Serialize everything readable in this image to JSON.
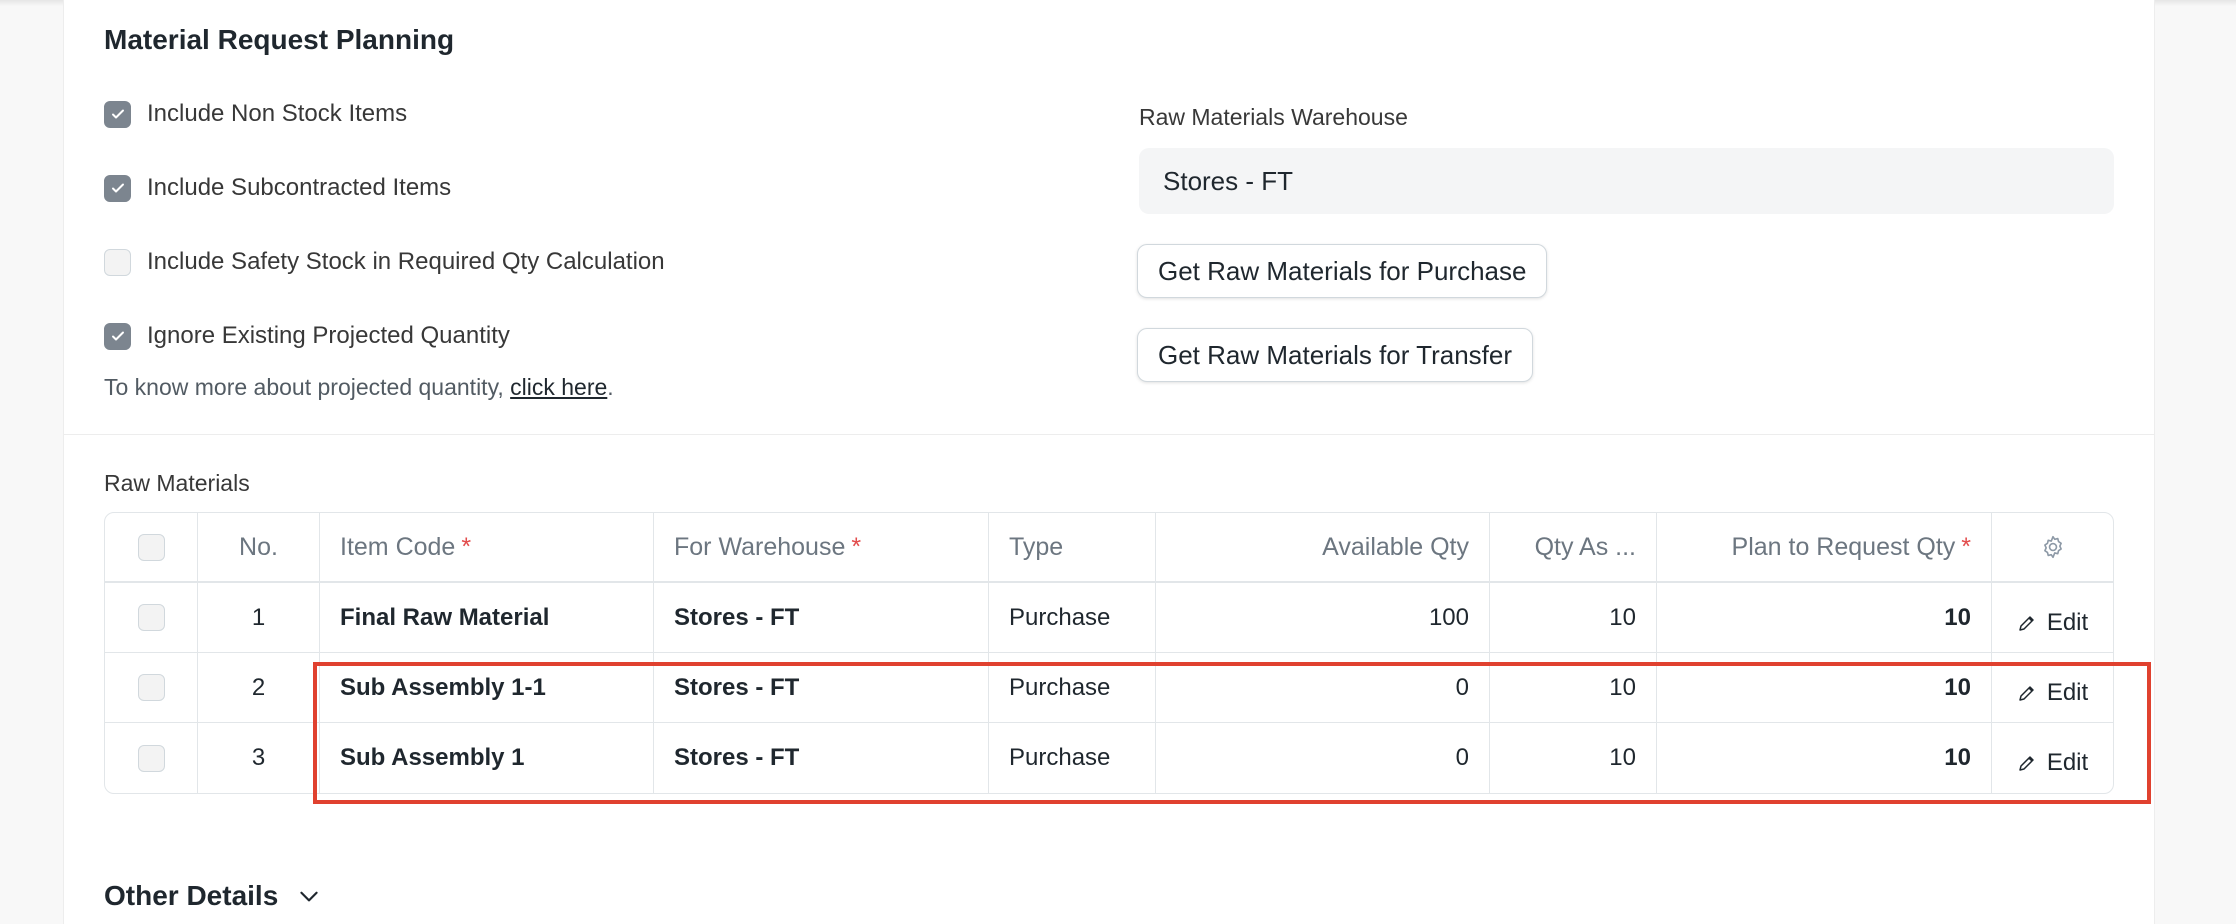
{
  "section": {
    "title": "Material Request Planning"
  },
  "checkboxes": [
    {
      "label": "Include Non Stock Items",
      "checked": true
    },
    {
      "label": "Include Subcontracted Items",
      "checked": true
    },
    {
      "label": "Include Safety Stock in Required Qty Calculation",
      "checked": false
    },
    {
      "label": "Ignore Existing Projected Quantity",
      "checked": true
    }
  ],
  "help": {
    "text": "To know more about projected quantity, ",
    "link": "click here",
    "suffix": "."
  },
  "warehouse": {
    "label": "Raw Materials Warehouse",
    "value": "Stores - FT"
  },
  "buttons": {
    "purchase": "Get Raw Materials for Purchase",
    "transfer": "Get Raw Materials for Transfer"
  },
  "table": {
    "label": "Raw Materials",
    "columns": {
      "no": "No.",
      "item_code": "Item Code",
      "warehouse": "For Warehouse",
      "type": "Type",
      "available": "Available Qty",
      "qty_as": "Qty As ...",
      "plan": "Plan to Request Qty"
    },
    "required_mark": "*",
    "rows": [
      {
        "no": "1",
        "item_code": "Final Raw Material",
        "warehouse": "Stores - FT",
        "type": "Purchase",
        "available": "100",
        "qty_as": "10",
        "plan": "10",
        "edit": "Edit"
      },
      {
        "no": "2",
        "item_code": "Sub Assembly 1-1",
        "warehouse": "Stores - FT",
        "type": "Purchase",
        "available": "0",
        "qty_as": "10",
        "plan": "10",
        "edit": "Edit"
      },
      {
        "no": "3",
        "item_code": "Sub Assembly 1",
        "warehouse": "Stores - FT",
        "type": "Purchase",
        "available": "0",
        "qty_as": "10",
        "plan": "10",
        "edit": "Edit"
      }
    ]
  },
  "other_details": {
    "title": "Other Details"
  },
  "colors": {
    "highlight": "#e0412f",
    "required": "#e24c4c",
    "checkbox_checked": "#7c858f"
  }
}
